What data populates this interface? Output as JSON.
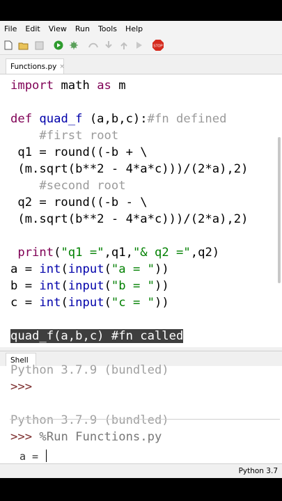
{
  "menu": [
    "File",
    "Edit",
    "View",
    "Run",
    "Tools",
    "Help"
  ],
  "toolbar": {
    "icons": [
      "new-file-icon",
      "open-folder-icon",
      "save-icon",
      "run-icon",
      "debug-icon",
      "step-over-icon",
      "step-into-icon",
      "step-out-icon",
      "resume-icon",
      "stop-icon"
    ],
    "stop_label": "STOP"
  },
  "editor": {
    "tab_label": "Functions.py",
    "tab_close": "×",
    "lines": {
      "l1_kw1": "import",
      "l1_mod": " math ",
      "l1_kw2": "as",
      "l1_rest": " m",
      "l2_kw": "def",
      "l2_name": " quad_f",
      "l2_rest": " (a,b,c):",
      "l2_comment": "#fn defined",
      "l3_comment": "#first root",
      "l4": " q1 = round((-b + \\",
      "l5": " (m.sqrt(b**2 - 4*a*c)))/(2*a),2)",
      "l6_comment": "#second root",
      "l7": " q2 = round((-b - \\",
      "l8": " (m.sqrt(b**2 - 4*a*c)))/(2*a),2)",
      "l9_fn": " print",
      "l9_open": "(",
      "l9_s1": "\"q1 =\"",
      "l9_mid": ",q1,",
      "l9_s2": "\"& q2 =\"",
      "l9_end": ",q2)",
      "l10_a": "a = ",
      "l10_int": "int",
      "l10_p1": "(",
      "l10_inp": "input",
      "l10_p2": "(",
      "l10_s": "\"a = \"",
      "l10_close": "))",
      "l11_a": "b = ",
      "l11_int": "int",
      "l11_p1": "(",
      "l11_inp": "input",
      "l11_p2": "(",
      "l11_s": "\"b = \"",
      "l11_close": "))",
      "l12_a": "c = ",
      "l12_int": "int",
      "l12_p1": "(",
      "l12_inp": "input",
      "l12_p2": "(",
      "l12_s": "\"c = \"",
      "l12_close": "))",
      "l13": "quad_f(a,b,c) #fn called"
    }
  },
  "shell": {
    "tab_label": "Shell",
    "line_top": "Python 3.7.9 (bundled)",
    "prompt1": ">>>",
    "line_version": "Python 3.7.9 (bundled)",
    "prompt2": ">>>",
    "run_cmd": " %Run Functions.py",
    "input_prompt": "a = "
  },
  "status": {
    "text": "Python 3.7"
  }
}
